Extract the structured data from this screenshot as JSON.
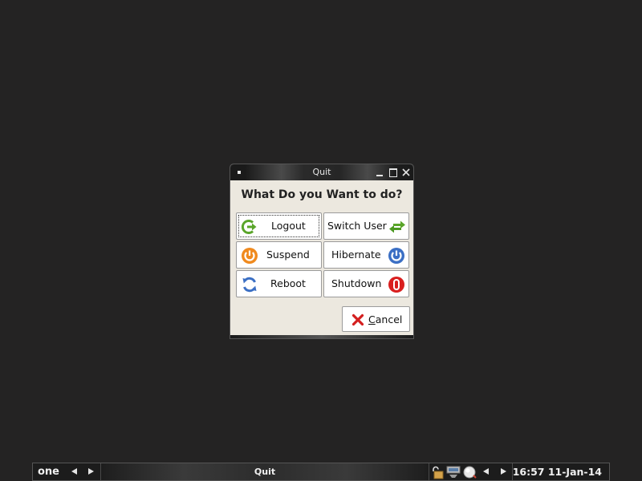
{
  "window": {
    "title": "Quit",
    "heading": "What Do you Want to do?"
  },
  "options": {
    "logout": "Logout",
    "switch_user": "Switch User",
    "suspend": "Suspend",
    "hibernate": "Hibernate",
    "reboot": "Reboot",
    "shutdown": "Shutdown"
  },
  "cancel": {
    "mnemonic": "C",
    "rest": "ancel"
  },
  "taskbar": {
    "desktop_name": "one",
    "task_title": "Quit",
    "clock": "16:57 11-Jan-14"
  },
  "colors": {
    "desktop": "#242323",
    "dialog": "#ece8df",
    "logout_green": "#5aa52a",
    "suspend_orange": "#f08a1e",
    "hibernate_blue": "#3b6fc4",
    "shutdown_red": "#d91f1f"
  }
}
